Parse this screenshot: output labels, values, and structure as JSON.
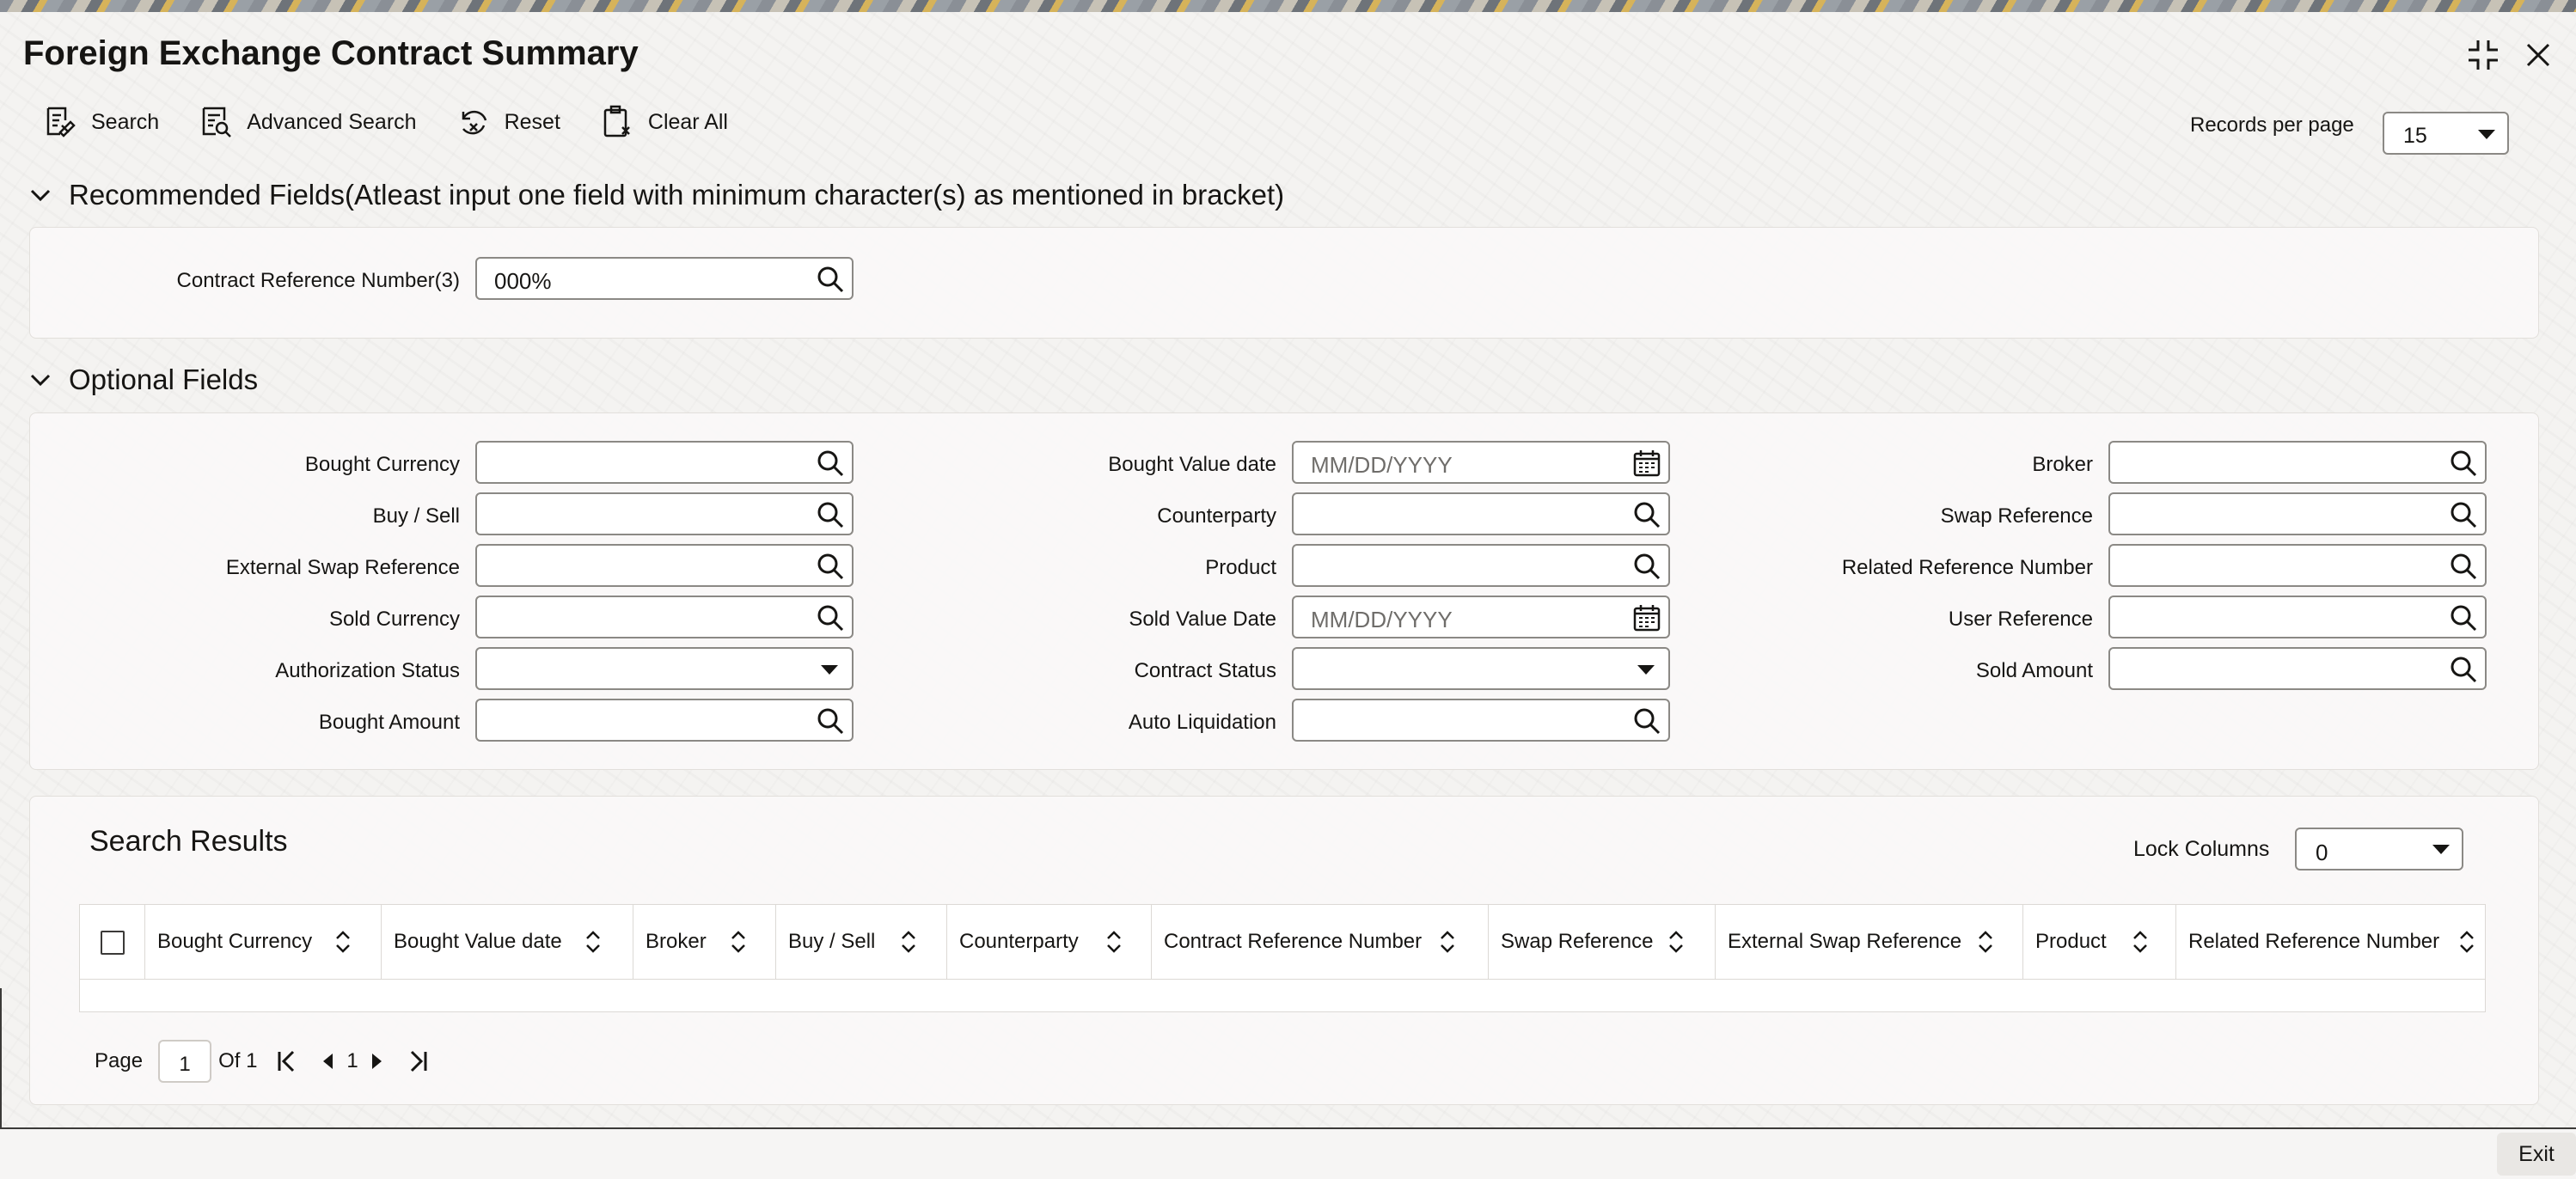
{
  "window": {
    "title": "Foreign Exchange Contract Summary"
  },
  "toolbar": {
    "search_label": "Search",
    "advanced_search_label": "Advanced Search",
    "reset_label": "Reset",
    "clear_all_label": "Clear All",
    "records_per_page_label": "Records per page",
    "records_per_page_value": "15"
  },
  "recommended": {
    "header": "Recommended Fields(Atleast input one field with minimum character(s) as mentioned in bracket)",
    "contract_ref_label": "Contract Reference Number(3)",
    "contract_ref_value": "000%"
  },
  "optional": {
    "header": "Optional Fields",
    "col1": {
      "bought_currency": "Bought Currency",
      "buy_sell": "Buy / Sell",
      "external_swap_reference": "External Swap Reference",
      "sold_currency": "Sold Currency",
      "authorization_status": "Authorization Status",
      "bought_amount": "Bought Amount"
    },
    "col2": {
      "bought_value_date": "Bought Value date",
      "counterparty": "Counterparty",
      "product": "Product",
      "sold_value_date": "Sold Value Date",
      "contract_status": "Contract Status",
      "auto_liquidation": "Auto Liquidation"
    },
    "col3": {
      "broker": "Broker",
      "swap_reference": "Swap Reference",
      "related_reference_number": "Related Reference Number",
      "user_reference": "User Reference",
      "sold_amount": "Sold Amount"
    },
    "date_placeholder": "MM/DD/YYYY"
  },
  "results": {
    "title": "Search Results",
    "lock_columns_label": "Lock Columns",
    "lock_columns_value": "0",
    "columns": [
      "Bought Currency",
      "Bought Value date",
      "Broker",
      "Buy / Sell",
      "Counterparty",
      "Contract Reference Number",
      "Swap Reference",
      "External Swap Reference",
      "Product",
      "Related Reference Number"
    ]
  },
  "pager": {
    "page_label": "Page",
    "page_value": "1",
    "of_label": "Of 1",
    "current": "1"
  },
  "footer": {
    "exit_label": "Exit"
  }
}
